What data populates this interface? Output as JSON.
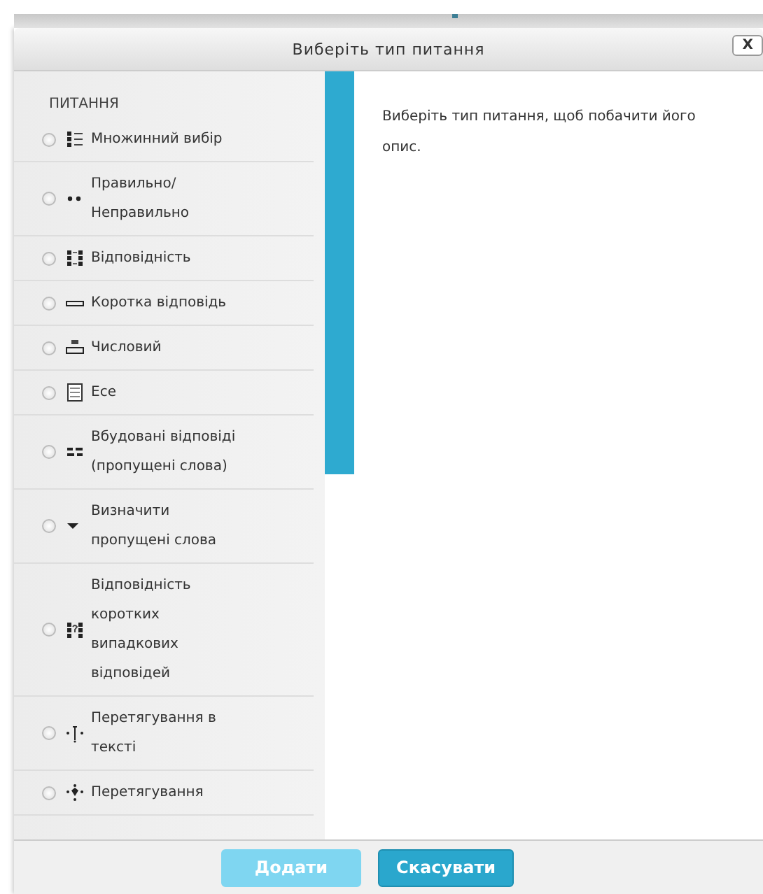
{
  "dialog": {
    "title": "Виберіть тип питання",
    "close": "X"
  },
  "list": {
    "heading": "ПИТАННЯ",
    "items": [
      {
        "label": "Множинний вибір",
        "kind": "multichoice",
        "selected": false
      },
      {
        "label": "Правильно/ Неправильно",
        "kind": "truefalse",
        "selected": false
      },
      {
        "label": "Відповідність",
        "kind": "match",
        "selected": false
      },
      {
        "label": "Коротка відповідь",
        "kind": "shortanswer",
        "selected": false
      },
      {
        "label": "Числовий",
        "kind": "numerical",
        "selected": false
      },
      {
        "label": "Есе",
        "kind": "essay",
        "selected": false
      },
      {
        "label": "Вбудовані відповіді (пропущені слова)",
        "kind": "cloze",
        "selected": false
      },
      {
        "label": "Визначити пропущені слова",
        "kind": "gapselect",
        "selected": false
      },
      {
        "label": "Відповідність коротких випадкових відповідей",
        "kind": "randommatch",
        "selected": false
      },
      {
        "label": "Перетягування в тексті",
        "kind": "ddwtos",
        "selected": false
      },
      {
        "label": "Перетягування",
        "kind": "ddimage",
        "selected": false
      }
    ]
  },
  "description": "Виберіть тип питання, щоб побачити його опис.",
  "buttons": [
    {
      "label": "Додати",
      "disabled": true
    },
    {
      "label": "Скасувати",
      "disabled": false
    }
  ]
}
